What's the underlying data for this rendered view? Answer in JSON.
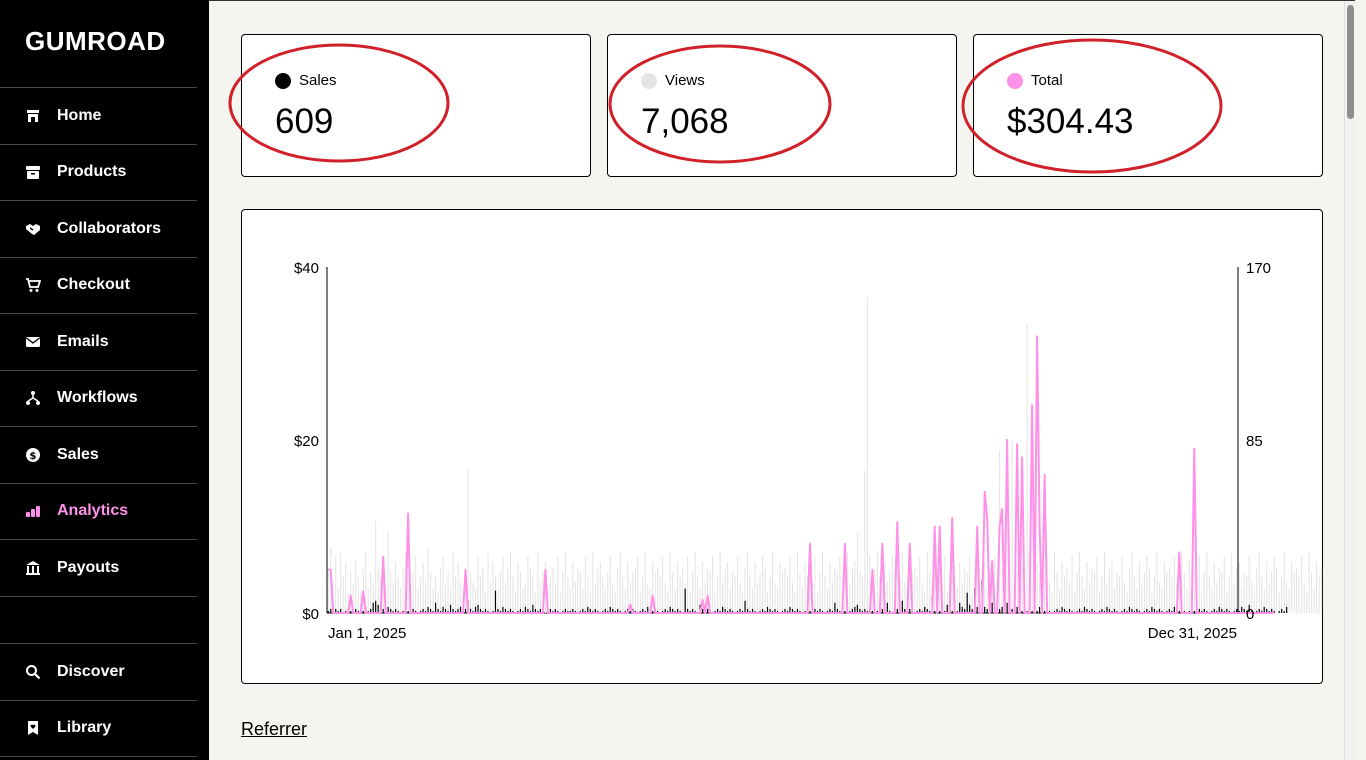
{
  "app": {
    "logo": "GUMROAD"
  },
  "sidebar": {
    "items": [
      {
        "label": "Home",
        "icon": "store-icon"
      },
      {
        "label": "Products",
        "icon": "archive-icon"
      },
      {
        "label": "Collaborators",
        "icon": "handshake-icon"
      },
      {
        "label": "Checkout",
        "icon": "cart-icon"
      },
      {
        "label": "Emails",
        "icon": "envelope-icon"
      },
      {
        "label": "Workflows",
        "icon": "workflow-icon"
      },
      {
        "label": "Sales",
        "icon": "dollar-circle-icon"
      },
      {
        "label": "Analytics",
        "icon": "bar-chart-icon",
        "active": true
      },
      {
        "label": "Payouts",
        "icon": "bank-icon"
      }
    ],
    "bottom": [
      {
        "label": "Discover",
        "icon": "search-icon"
      },
      {
        "label": "Library",
        "icon": "bookmark-heart-icon"
      }
    ]
  },
  "stats": {
    "sales": {
      "label": "Sales",
      "value": "609",
      "color": "#000000"
    },
    "views": {
      "label": "Views",
      "value": "7,068",
      "color": "#e5e5e5"
    },
    "total": {
      "label": "Total",
      "value": "$304.43",
      "color": "#ff90e8"
    }
  },
  "annotation_color": "#d0202a",
  "chart_data": {
    "type": "bar",
    "x_start_label": "Jan 1, 2025",
    "x_end_label": "Dec 31, 2025",
    "y_left_ticks": [
      "$0",
      "$20",
      "$40"
    ],
    "y_right_ticks": [
      "0",
      "85",
      "170"
    ],
    "ylim_left": [
      0,
      40
    ],
    "ylim_right": [
      0,
      170
    ],
    "days": 365,
    "series": [
      {
        "name": "Views",
        "axis": "right",
        "kind": "bar",
        "color": "#e3e3e3",
        "values": [
          22,
          32,
          15,
          28,
          12,
          30,
          18,
          25,
          10,
          20,
          14,
          26,
          18,
          10,
          22,
          30,
          12,
          20,
          15,
          45,
          22,
          18,
          28,
          12,
          40,
          20,
          15,
          25,
          18,
          12,
          22,
          30,
          15,
          10,
          20,
          28,
          12,
          18,
          25,
          15,
          32,
          20,
          12,
          18,
          10,
          22,
          28,
          14,
          20,
          12,
          30,
          18,
          25,
          15,
          10,
          22,
          70,
          20,
          15,
          12,
          28,
          18,
          22,
          10,
          30,
          15,
          25,
          18,
          12,
          20,
          28,
          15,
          22,
          30,
          18,
          10,
          25,
          20,
          12,
          15,
          28,
          22,
          18,
          10,
          30,
          15,
          20,
          25,
          12,
          18,
          22,
          15,
          28,
          10,
          20,
          30,
          18,
          12,
          25,
          15,
          22,
          20,
          12,
          28,
          18,
          10,
          30,
          15,
          22,
          25,
          18,
          12,
          20,
          28,
          15,
          10,
          22,
          30,
          18,
          12,
          25,
          15,
          20,
          22,
          28,
          10,
          18,
          30,
          15,
          12,
          25,
          20,
          22,
          18,
          28,
          15,
          10,
          30,
          20,
          12,
          25,
          18,
          22,
          15,
          28,
          10,
          20,
          30,
          18,
          12,
          25,
          15,
          22,
          20,
          28,
          10,
          18,
          30,
          15,
          22,
          25,
          12,
          20,
          18,
          28,
          15,
          10,
          22,
          30,
          18,
          12,
          25,
          15,
          20,
          28,
          22,
          10,
          18,
          30,
          15,
          12,
          25,
          20,
          22,
          18,
          28,
          15,
          10,
          30,
          20,
          12,
          25,
          18,
          22,
          15,
          28,
          10,
          20,
          30,
          18,
          12,
          25,
          15,
          22,
          20,
          28,
          10,
          18,
          30,
          15,
          22,
          25,
          40,
          20,
          18,
          70,
          155,
          28,
          15,
          22,
          30,
          18,
          12,
          25,
          15,
          20,
          28,
          22,
          10,
          18,
          30,
          15,
          12,
          25,
          20,
          22,
          18,
          28,
          15,
          10,
          30,
          20,
          12,
          25,
          18,
          22,
          15,
          28,
          10,
          20,
          30,
          18,
          12,
          25,
          15,
          22,
          20,
          28,
          10,
          18,
          30,
          15,
          22,
          25,
          12,
          20,
          18,
          28,
          15,
          80,
          22,
          30,
          18,
          12,
          85,
          15,
          20,
          28,
          22,
          10,
          142,
          30,
          15,
          12,
          25,
          20,
          22,
          18,
          28,
          15,
          10,
          30,
          20,
          12,
          25,
          18,
          22,
          15,
          28,
          10,
          20,
          30,
          18,
          12,
          25,
          15,
          22,
          20,
          28,
          10,
          18,
          30,
          15,
          22,
          25,
          12,
          20,
          18,
          28,
          15,
          10,
          22,
          30,
          18,
          12,
          25,
          15,
          20,
          28,
          22,
          10,
          18,
          30,
          15,
          12,
          25,
          20,
          22,
          18,
          28,
          15,
          10,
          30,
          20,
          12,
          25,
          18,
          22,
          15,
          28,
          10,
          20,
          30,
          18,
          12,
          25,
          15,
          22,
          20,
          28,
          10,
          18,
          30,
          15,
          22,
          25,
          12,
          20,
          18,
          28,
          15,
          10,
          22,
          30,
          18,
          12,
          25,
          15,
          20,
          28,
          22,
          10,
          18,
          30,
          15,
          12,
          25,
          20,
          22,
          18,
          28,
          15,
          10,
          30,
          20,
          12,
          25,
          18,
          22,
          15,
          28,
          10,
          20,
          30,
          18,
          12,
          47,
          15,
          22
        ]
      },
      {
        "name": "Sales",
        "axis": "right",
        "kind": "bar",
        "color": "#000000",
        "values": [
          1,
          2,
          3,
          2,
          1,
          2,
          0,
          1,
          2,
          1,
          0,
          2,
          1,
          0,
          1,
          3,
          1,
          2,
          5,
          6,
          4,
          3,
          2,
          1,
          3,
          2,
          1,
          2,
          1,
          0,
          1,
          2,
          1,
          1,
          2,
          1,
          0,
          1,
          2,
          1,
          3,
          2,
          1,
          5,
          2,
          1,
          3,
          2,
          1,
          4,
          2,
          1,
          2,
          3,
          1,
          2,
          6,
          2,
          1,
          3,
          4,
          2,
          1,
          2,
          1,
          0,
          1,
          11,
          2,
          1,
          3,
          2,
          1,
          2,
          1,
          0,
          1,
          2,
          1,
          3,
          2,
          1,
          4,
          2,
          1,
          2,
          1,
          0,
          1,
          2,
          1,
          2,
          1,
          0,
          1,
          2,
          1,
          1,
          2,
          1,
          0,
          1,
          2,
          1,
          3,
          2,
          1,
          2,
          1,
          0,
          1,
          2,
          1,
          3,
          2,
          1,
          2,
          1,
          0,
          1,
          2,
          1,
          2,
          1,
          0,
          1,
          2,
          1,
          3,
          2,
          1,
          2,
          1,
          0,
          1,
          2,
          1,
          3,
          2,
          1,
          2,
          1,
          0,
          12,
          2,
          1,
          2,
          1,
          0,
          4,
          2,
          1,
          2,
          1,
          0,
          1,
          2,
          1,
          3,
          2,
          1,
          2,
          1,
          0,
          1,
          2,
          1,
          6,
          2,
          1,
          2,
          1,
          0,
          1,
          2,
          1,
          3,
          2,
          1,
          2,
          1,
          0,
          1,
          2,
          1,
          3,
          2,
          1,
          2,
          1,
          0,
          1,
          2,
          1,
          4,
          2,
          1,
          2,
          1,
          0,
          1,
          2,
          1,
          5,
          2,
          1,
          2,
          1,
          0,
          1,
          2,
          3,
          4,
          2,
          1,
          2,
          1,
          0,
          1,
          2,
          1,
          4,
          2,
          1,
          5,
          1,
          0,
          1,
          2,
          1,
          6,
          2,
          1,
          2,
          1,
          0,
          1,
          2,
          1,
          3,
          2,
          1,
          8,
          1,
          0,
          1,
          2,
          1,
          4,
          2,
          1,
          2,
          1,
          5,
          3,
          2,
          10,
          4,
          2,
          12,
          3,
          2,
          16,
          3,
          2,
          4,
          5,
          3,
          4,
          2,
          3,
          2,
          5,
          3,
          2,
          1,
          3,
          2,
          1,
          2,
          1,
          0,
          1,
          2,
          1,
          3,
          2,
          1,
          2,
          1,
          0,
          1,
          2,
          1,
          3,
          2,
          1,
          2,
          1,
          0,
          1,
          2,
          1,
          3,
          2,
          1,
          2,
          1,
          0,
          1,
          2,
          1,
          3,
          2,
          1,
          2,
          1,
          0,
          1,
          2,
          1,
          3,
          2,
          1,
          2,
          1,
          0,
          1,
          2,
          1,
          3,
          2,
          1,
          2,
          1,
          0,
          1,
          2,
          1,
          3,
          2,
          1,
          2,
          1,
          0,
          1,
          2,
          1,
          3,
          2,
          1,
          2,
          1,
          0,
          1,
          2,
          1,
          3,
          2,
          1,
          2,
          1,
          0,
          1,
          2,
          1,
          3,
          2,
          1,
          4,
          1,
          0,
          1,
          2,
          1,
          3,
          2,
          1,
          2,
          1,
          0,
          1,
          2,
          1,
          3
        ]
      },
      {
        "name": "Total",
        "axis": "left",
        "kind": "line",
        "color": "#ff90e8",
        "values": [
          5,
          0,
          0,
          0,
          0,
          0,
          0,
          0,
          0,
          2,
          0,
          0,
          0,
          0,
          0,
          0,
          0,
          0,
          0,
          0,
          0,
          0,
          0,
          0,
          0,
          0,
          0,
          0,
          0,
          0,
          0,
          0,
          0,
          0,
          0,
          0,
          0,
          0,
          0,
          0,
          0,
          0,
          0,
          0,
          0,
          0,
          0,
          0,
          0,
          0,
          0,
          0,
          0,
          0,
          0,
          0,
          0,
          0,
          0,
          0,
          0,
          0,
          0,
          0,
          0,
          0,
          0,
          0,
          0,
          0,
          0,
          0,
          0,
          0,
          0,
          0,
          0,
          0,
          0,
          0,
          0,
          0,
          0,
          0,
          0,
          0,
          0,
          0,
          0,
          0,
          0,
          0,
          0,
          0,
          0,
          0,
          0,
          0,
          0,
          0,
          0,
          0,
          0,
          0,
          0,
          0,
          0,
          0,
          0,
          0,
          0,
          0,
          0,
          0,
          0,
          0,
          0,
          0,
          0,
          0,
          0,
          0,
          0,
          0,
          0,
          0,
          0,
          0,
          0,
          0,
          0,
          0,
          0,
          0,
          0,
          0,
          0,
          0,
          0,
          0,
          0,
          0,
          0,
          0,
          0,
          0,
          0,
          0,
          0,
          0,
          0,
          0,
          0,
          0,
          0,
          0,
          0,
          0,
          0,
          0,
          0,
          0,
          0,
          0,
          0,
          0,
          0,
          0,
          0,
          0,
          0,
          0,
          0,
          0,
          0,
          0,
          0,
          0,
          0,
          0,
          0,
          0,
          0,
          0,
          0,
          0,
          0,
          0,
          0,
          0,
          0,
          0,
          0,
          0,
          0,
          0,
          0,
          0,
          0,
          0,
          0,
          0,
          0,
          0,
          0,
          0,
          0,
          0,
          0,
          0,
          0,
          0,
          0,
          0,
          0,
          0,
          0,
          0,
          0,
          0,
          0,
          0,
          0,
          0,
          0,
          0,
          0,
          0,
          0,
          0,
          0,
          0,
          0,
          0,
          0,
          0,
          0,
          0,
          0,
          0,
          0,
          0,
          0,
          0,
          0,
          0,
          0,
          0,
          0,
          0,
          0,
          0,
          0,
          0,
          0,
          0,
          0,
          0,
          0,
          0,
          0,
          0,
          0,
          0,
          0,
          0,
          0,
          0,
          0,
          0,
          0,
          0,
          0,
          0,
          0,
          0,
          0,
          0,
          0,
          0,
          0,
          0,
          0,
          0,
          0,
          0,
          0,
          0,
          0,
          0,
          0,
          0,
          0,
          0,
          0,
          0,
          0,
          0,
          0,
          0,
          0,
          0,
          0,
          0,
          0,
          0,
          0,
          0,
          0,
          0,
          0,
          0,
          0,
          0,
          0,
          0,
          0,
          0,
          0,
          0,
          0,
          0,
          0,
          0,
          0,
          0,
          0,
          0,
          0,
          0,
          0,
          0,
          0,
          0,
          0,
          0,
          0,
          0,
          0,
          0,
          0,
          0,
          0,
          0,
          0,
          0,
          0,
          0,
          0,
          0,
          0,
          0,
          0,
          0,
          0,
          0,
          0,
          0,
          0,
          0,
          0,
          0,
          0,
          0,
          0,
          0,
          0,
          0,
          0,
          0,
          0,
          0,
          0,
          0,
          0,
          0,
          0,
          0,
          0,
          0
        ],
        "peaks": [
          [
            1,
            5
          ],
          [
            14,
            2.5
          ],
          [
            22,
            6.5
          ],
          [
            32,
            11.5
          ],
          [
            55,
            5
          ],
          [
            87,
            5
          ],
          [
            121,
            1
          ],
          [
            130,
            2
          ],
          [
            150,
            1.5
          ],
          [
            152,
            2
          ],
          [
            193,
            8
          ],
          [
            207,
            8
          ],
          [
            218,
            5
          ],
          [
            222,
            8
          ],
          [
            228,
            10.5
          ],
          [
            233,
            8
          ],
          [
            243,
            10
          ],
          [
            245,
            10
          ],
          [
            250,
            11
          ],
          [
            260,
            10
          ],
          [
            263,
            14
          ],
          [
            264,
            11
          ],
          [
            266,
            6
          ],
          [
            269,
            10
          ],
          [
            270,
            12
          ],
          [
            272,
            20
          ],
          [
            276,
            19.5
          ],
          [
            278,
            18
          ],
          [
            282,
            24
          ],
          [
            284,
            32
          ],
          [
            285,
            10
          ],
          [
            287,
            16
          ],
          [
            341,
            7
          ],
          [
            347,
            19
          ]
        ]
      }
    ]
  }
}
